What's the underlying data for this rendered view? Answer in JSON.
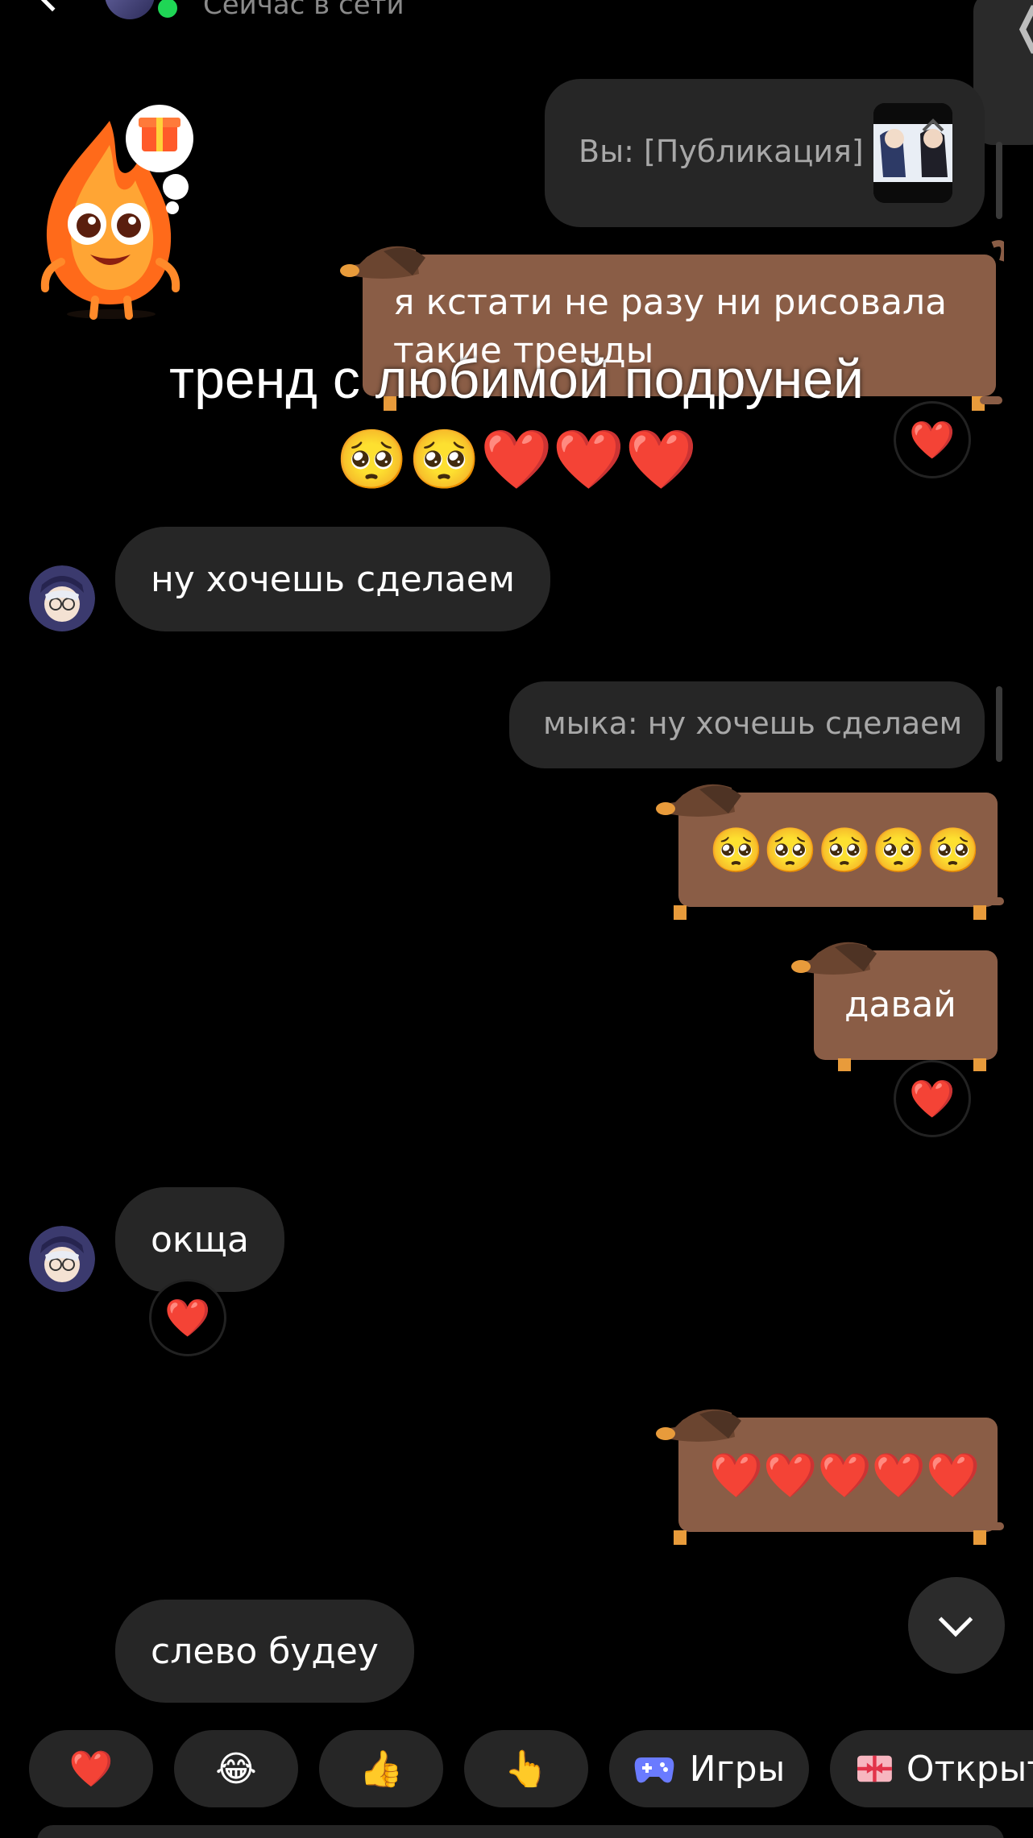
{
  "header": {
    "status": "Сейчас в сети"
  },
  "overlay": {
    "caption_line1": "тренд с любимой подруней",
    "caption_line2": "🥺🥺❤️❤️❤️"
  },
  "messages": {
    "reply1": {
      "text": "Вы: [Публикация]"
    },
    "sent1": {
      "text": "я кстати не разу ни рисовала такие тренды"
    },
    "recv1": {
      "text": "ну хочешь сделаем"
    },
    "reply2": {
      "text": "мыка: ну хочешь сделаем"
    },
    "sent2": {
      "emojis": "🥺🥺🥺🥺🥺"
    },
    "sent3": {
      "text": "давай"
    },
    "recv2": {
      "text": "окща"
    },
    "sent4": {
      "emojis": "❤️❤️❤️❤️❤️"
    },
    "recv3": {
      "text": "слево будеу"
    },
    "reaction": "❤️"
  },
  "quick_replies": {
    "heart": "❤️",
    "laugh": "😂",
    "thumbs": "👍",
    "point": "👆",
    "games_label": "Игры",
    "open_label": "Открыт"
  }
}
